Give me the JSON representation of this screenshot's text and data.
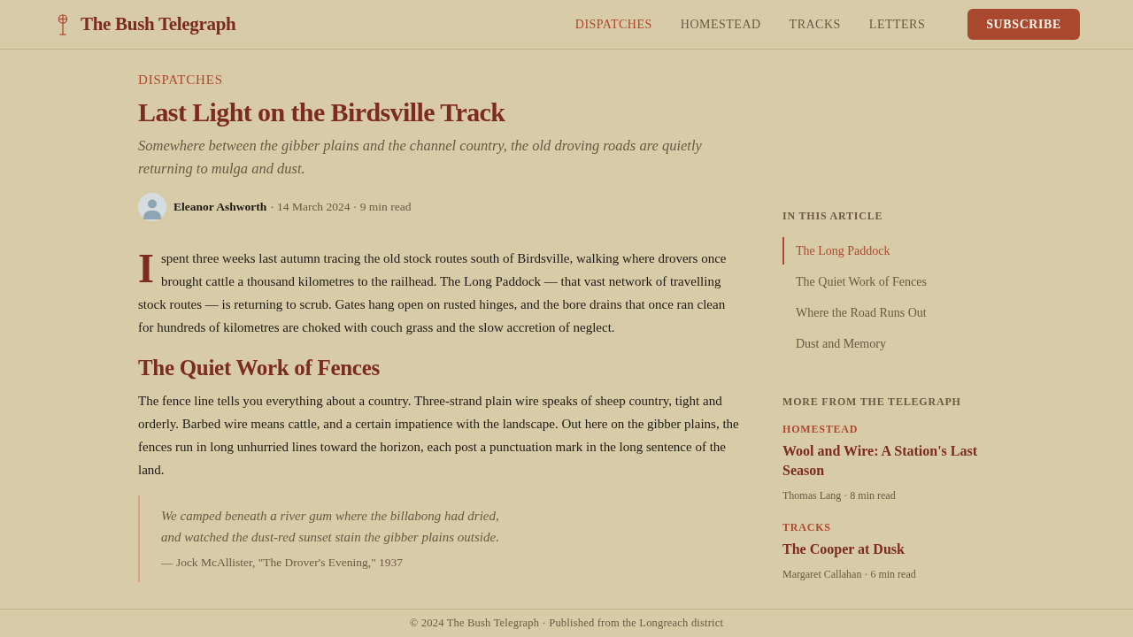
{
  "header": {
    "brand": "The Bush Telegraph",
    "nav": [
      {
        "label": "DISPATCHES",
        "selected": true
      },
      {
        "label": "HOMESTEAD",
        "selected": false
      },
      {
        "label": "TRACKS",
        "selected": false
      },
      {
        "label": "LETTERS",
        "selected": false
      }
    ],
    "subscribe_button": "SUBSCRIBE"
  },
  "article": {
    "section": "DISPATCHES",
    "title": "Last Light on the Birdsville Track",
    "subtitle": "Somewhere between the gibber plains and the channel country, the old droving roads are quietly returning to mulga and dust.",
    "byline": {
      "author": "Eleanor Ashworth",
      "meta": "· 14 March 2024 · 9 min read"
    },
    "body": [
      {
        "kind": "paragraph",
        "drop_cap": "I",
        "text": "spent three weeks last autumn tracing the old stock routes south of Birdsville, walking where drovers once brought cattle a thousand kilometres to the railhead. The Long Paddock — that vast network of travelling stock routes — is returning to scrub. Gates hang open on rusted hinges, and the bore drains that once ran clean for hundreds of kilometres are choked with couch grass and the slow accretion of neglect."
      },
      {
        "kind": "heading",
        "text": "The Quiet Work of Fences"
      },
      {
        "kind": "paragraph",
        "text": "The fence line tells you everything about a country. Three-strand plain wire speaks of sheep country, tight and orderly. Barbed wire means cattle, and a certain impatience with the landscape. Out here on the gibber plains, the fences run in long unhurried lines toward the horizon, each post a punctuation mark in the long sentence of the land."
      },
      {
        "kind": "quote",
        "lines": [
          "We camped beneath a river gum where the billabong had dried,",
          "and watched the dust-red sunset stain the gibber plains outside."
        ],
        "attribution": "— Jock McAllister, \"The Drover's Evening,\" 1937"
      }
    ]
  },
  "sidebar": {
    "toc": {
      "title": "IN THIS ARTICLE",
      "items": [
        {
          "label": "The Long Paddock",
          "selected": true
        },
        {
          "label": "The Quiet Work of Fences",
          "selected": false
        },
        {
          "label": "Where the Road Runs Out",
          "selected": false
        },
        {
          "label": "Dust and Memory",
          "selected": false
        }
      ]
    },
    "more": {
      "title": "MORE FROM THE TELEGRAPH",
      "stories": [
        {
          "section": "HOMESTEAD",
          "title": "Wool and Wire: A Station's Last Season",
          "meta": "Thomas Lang · 8 min read"
        },
        {
          "section": "TRACKS",
          "title": "The Cooper at Dusk",
          "meta": "Margaret Callahan · 6 min read"
        }
      ]
    }
  },
  "footer": "© 2024 The Bush Telegraph · Published from the Longreach district"
}
